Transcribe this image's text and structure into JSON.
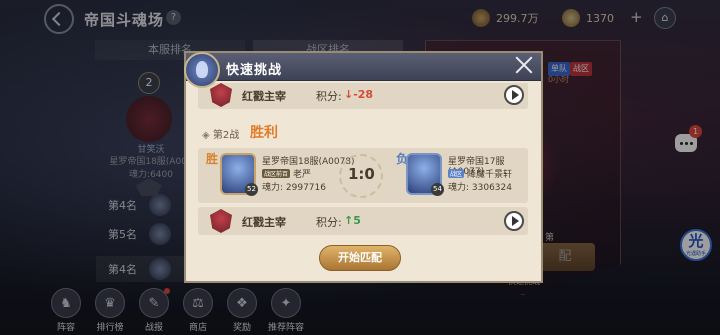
{
  "header": {
    "title": "帝国斗魂场",
    "help_icon": "?",
    "currency1": "299.7万",
    "currency2": "1370",
    "plus": "+"
  },
  "tabs": [
    "本服排名",
    "战区排名"
  ],
  "champion": {
    "rank": "2",
    "name": "甘笑沃",
    "server": "星罗帝国18服(A007",
    "power": "魂力:6400"
  },
  "ranking_rows": [
    "第4名",
    "第5名",
    "第4名"
  ],
  "right_panel": {
    "badge1": "单队",
    "badge2": "战区",
    "sub": "0小时",
    "text1": "第",
    "button": "配",
    "text2": "快速挑战"
  },
  "chat_badge": "1",
  "float_badge": {
    "char": "光",
    "label": "光遇助手"
  },
  "bottom_nav": [
    "阵容",
    "排行榜",
    "战报",
    "商店",
    "奖励",
    "推荐阵容"
  ],
  "modal": {
    "title": "快速挑战",
    "top_row": {
      "title": "红戳主宰",
      "points_label": "积分:",
      "points": "↓-28"
    },
    "battle_label": "第2战",
    "battle_result": "胜利",
    "left_player": {
      "mark": "胜",
      "level": "52",
      "server": "星罗帝国18服(A0078)",
      "tag": "战区前百",
      "name": "老严",
      "power": "魂力: 2997716"
    },
    "score": "1:0",
    "right_player": {
      "mark": "负",
      "level": "54",
      "server": "星罗帝国17服(A0077)",
      "tag": "战区",
      "name": "降魔千景轩",
      "power": "魂力: 3306324"
    },
    "bottom_row": {
      "title": "红戳主宰",
      "points_label": "积分:",
      "points": "↑5"
    },
    "start_button": "开始匹配"
  }
}
